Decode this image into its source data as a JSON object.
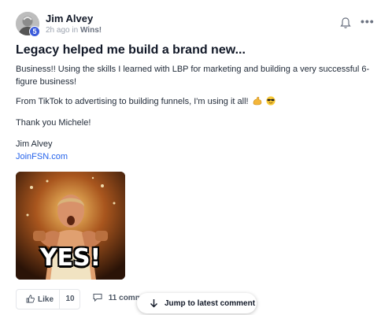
{
  "post": {
    "author": "Jim Alvey",
    "level": "5",
    "time": "2h ago",
    "in_word": "in",
    "category": "Wins!",
    "title": "Legacy helped me build a brand new...",
    "paragraphs": [
      "Business!! Using the skills I learned with LBP for marketing and building a very successful 6-figure business!",
      "From TikTok to advertising to building funnels, I'm using it all!",
      "Thank you Michele!",
      "Jim Alvey"
    ],
    "link_text": "JoinFSN.com",
    "emojis": [
      "flexed-biceps-emoji",
      "sunglasses-face-emoji"
    ],
    "gif": {
      "caption": "YES!",
      "watermark": "W"
    }
  },
  "actions": {
    "like_label": "Like",
    "like_count": "10",
    "comments_label": "11 comm"
  },
  "jump": {
    "label": "Jump to latest comment"
  },
  "colors": {
    "link": "#2563eb",
    "badge": "#3b5bdb",
    "muted": "#9ca3af"
  }
}
